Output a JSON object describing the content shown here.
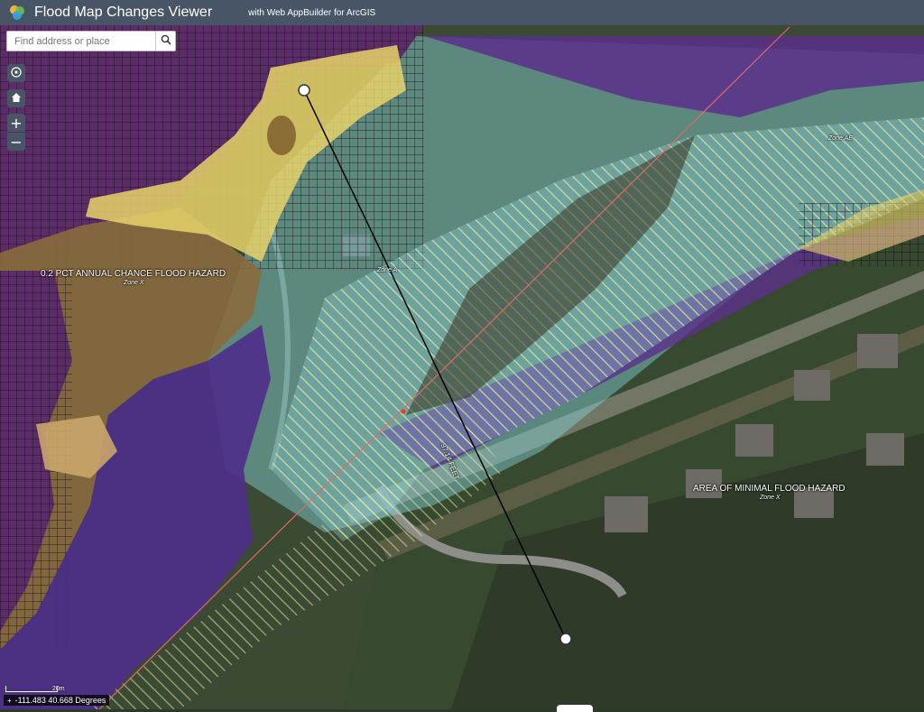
{
  "header": {
    "title": "Flood Map Changes Viewer",
    "subtitle": "with Web AppBuilder for ArcGIS",
    "logo_icon": "arcgis-app-logo"
  },
  "search": {
    "placeholder": "Find address or place",
    "button_icon": "search-icon"
  },
  "map_controls": {
    "locate_icon": "locate-icon",
    "home_icon": "home-icon",
    "zoom_in": "+",
    "zoom_out": "−"
  },
  "map_labels": {
    "flood_02pct": "0.2 PCT ANNUAL CHANCE FLOOD HAZARD",
    "flood_02pct_zone": "Zone X",
    "minimal": "AREA OF MINIMAL FLOOD HAZARD",
    "minimal_zone": "Zone X",
    "zone_a": "Zone A",
    "zone_ae": "Zone AE",
    "measure": "97.14 FEET"
  },
  "scale": {
    "label": "20m"
  },
  "coordinates": {
    "text": "-111.483 40.668 Degrees"
  },
  "colors": {
    "header_bg": "#485566",
    "purple_zone": "#5b2f8a",
    "yellow_zone": "#e8d36a",
    "cyan_zone": "#7fd0d6",
    "measure_line": "#000000"
  }
}
